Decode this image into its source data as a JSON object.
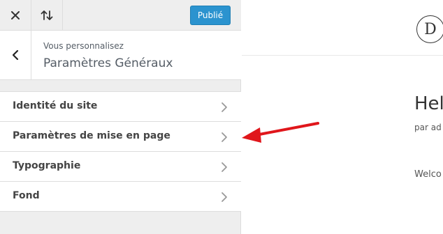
{
  "topbar": {
    "close_icon": "close-icon",
    "toggle_icon": "sort-arrows-icon",
    "publish_label": "Publié"
  },
  "header": {
    "back_icon": "chevron-left-icon",
    "subtitle": "Vous personnalisez",
    "title": "Paramètres Généraux"
  },
  "sections": [
    {
      "label": "Identité du site"
    },
    {
      "label": "Paramètres de mise en page"
    },
    {
      "label": "Typographie"
    },
    {
      "label": "Fond"
    }
  ],
  "preview": {
    "logo_letter": "D",
    "post_title": "Hel",
    "post_meta": "par ad",
    "post_excerpt": "Welco"
  },
  "colors": {
    "publish_button": "#2b93cf",
    "annotation_arrow": "#e0161b"
  }
}
